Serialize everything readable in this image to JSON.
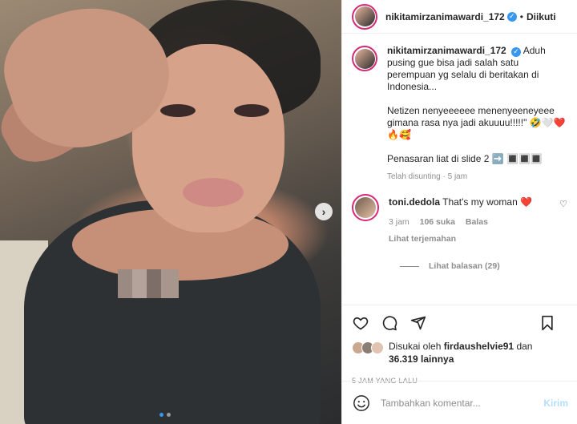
{
  "post": {
    "username": "nikitamirzanimawardi_172",
    "follow_label": "Diikuti",
    "separator": "•",
    "next_arrow": "›",
    "slide_count": 2,
    "active_slide": 1
  },
  "caption": {
    "author": "nikitamirzanimawardi_172",
    "line1": "Aduh pusing gue bisa jadi salah satu perempuan yg selalu di beritakan di Indonesia...",
    "line2": "Netizen nenyeeeeee menenyeeneyeee gimana rasa nya jadi akuuuu!!!!!\" 🤣🤍❤️🔥🥰",
    "line3": "Penasaran liat di slide 2 ➡️ 🔳🔳🔳",
    "edited": "Telah disunting · 5 jam"
  },
  "comment": {
    "author": "toni.dedola",
    "text": "That's my woman ❤️",
    "time": "3 jam",
    "likes": "106 suka",
    "reply": "Balas",
    "translate": "Lihat terjemahan",
    "view_replies": "Lihat balasan (29)"
  },
  "likes": {
    "prefix": "Disukai oleh",
    "user": "firdaushelvie91",
    "and": "dan",
    "count": "36.319 lainnya"
  },
  "timestamp": "5 JAM YANG LALU",
  "add_comment": {
    "placeholder": "Tambahkan komentar...",
    "post_label": "Kirim"
  },
  "icons": {
    "verified": "✓",
    "heart_small": "♡"
  },
  "colors": {
    "accent": "#3897f0",
    "story_ring": "#d62976",
    "muted": "#8e8e8e",
    "post_disabled": "#b2dffc"
  }
}
